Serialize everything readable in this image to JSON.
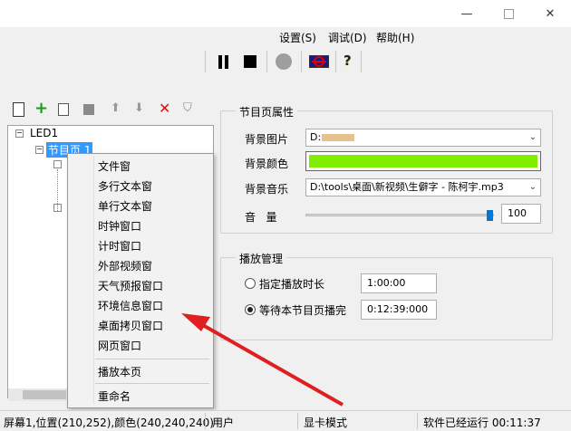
{
  "menu": [
    {
      "label": "设置(S)"
    },
    {
      "label": "调试(D)"
    },
    {
      "label": "帮助(H)"
    }
  ],
  "toolbar": [
    "pause-icon",
    "stop-icon",
    "record-icon",
    "screen-no-icon",
    "help-icon"
  ],
  "tree": {
    "root": "LED1",
    "program": "节目页 1"
  },
  "tree_toolbar": [
    "new-page-icon",
    "add-icon",
    "copy-icon",
    "paste-icon",
    "move-up-icon",
    "move-down-icon",
    "delete-icon",
    "tree-icon"
  ],
  "context_menu": {
    "items": [
      "文件窗",
      "多行文本窗",
      "单行文本窗",
      "时钟窗口",
      "计时窗口",
      "外部视频窗",
      "天气预报窗口",
      "环境信息窗口",
      "桌面拷贝窗口",
      "网页窗口"
    ],
    "play": "播放本页",
    "rename": "重命名"
  },
  "props": {
    "title": "节目页属性",
    "bg_image_label": "背景图片",
    "bg_image_value": "D:",
    "bg_color_label": "背景颜色",
    "bg_color": "#80ee00",
    "bg_music_label": "背景音乐",
    "bg_music_value": "D:\\tools\\桌面\\新视频\\生僻字 - 陈柯宇.mp3",
    "volume_label": "音   量",
    "volume_value": "100",
    "volume_level": 1.0
  },
  "playback": {
    "title": "播放管理",
    "opt1_label": "指定播放时长",
    "opt1_value": "1:00:00",
    "opt2_label": "等待本节目页播完",
    "opt2_value": "0:12:39:000",
    "selected": 2
  },
  "status": {
    "pos": "屏幕1,位置(210,252),颜色(240,240,240)",
    "user": "用户",
    "mode": "显卡模式",
    "runtime": "软件已经运行 00:11:37"
  },
  "colors": {
    "arrow": "#e02020",
    "selection": "#3399ff"
  }
}
